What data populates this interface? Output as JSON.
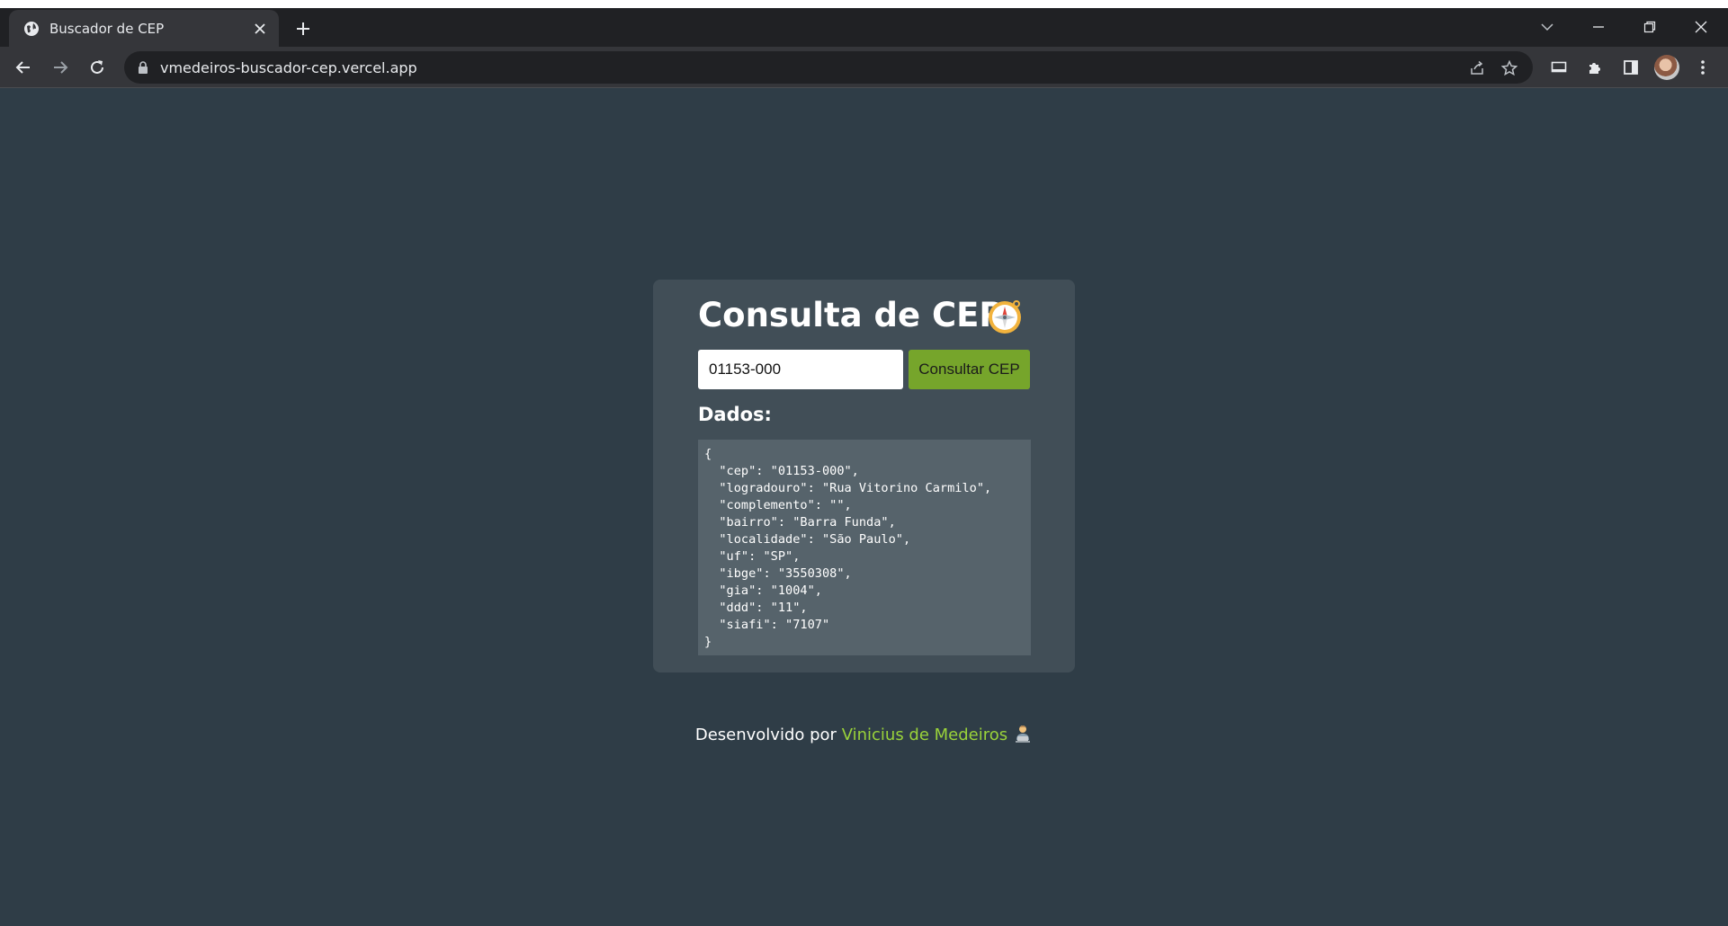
{
  "browser": {
    "tab_title": "Buscador de CEP",
    "url": "vmedeiros-buscador-cep.vercel.app",
    "icons": [
      "globe-icon",
      "close-icon",
      "plus-icon",
      "chevron-down-icon",
      "minimize-icon",
      "restore-icon",
      "close-window-icon",
      "back-icon",
      "forward-icon",
      "reload-icon",
      "lock-icon",
      "share-icon",
      "star-icon",
      "cast-icon",
      "puzzle-icon",
      "sidepanel-icon",
      "kebab-menu-icon"
    ]
  },
  "app": {
    "title": "Consulta de CEP",
    "title_icon": "compass-icon",
    "cep_input_value": "01153-000",
    "consult_button_label": "Consultar CEP",
    "dados_label": "Dados:",
    "accent_button_color": "#76a52b",
    "link_color": "#9ad33a",
    "json_lines": [
      "{",
      "  \"cep\": \"01153-000\",",
      "  \"logradouro\": \"Rua Vitorino Carmilo\",",
      "  \"complemento\": \"\",",
      "  \"bairro\": \"Barra Funda\",",
      "  \"localidade\": \"São Paulo\",",
      "  \"uf\": \"SP\",",
      "  \"ibge\": \"3550308\",",
      "  \"gia\": \"1004\",",
      "  \"ddd\": \"11\",",
      "  \"siafi\": \"7107\"",
      "}"
    ]
  },
  "footer": {
    "prefix": "Desenvolvido por ",
    "author": "Vinicius de Medeiros",
    "icon": "technologist-icon"
  }
}
